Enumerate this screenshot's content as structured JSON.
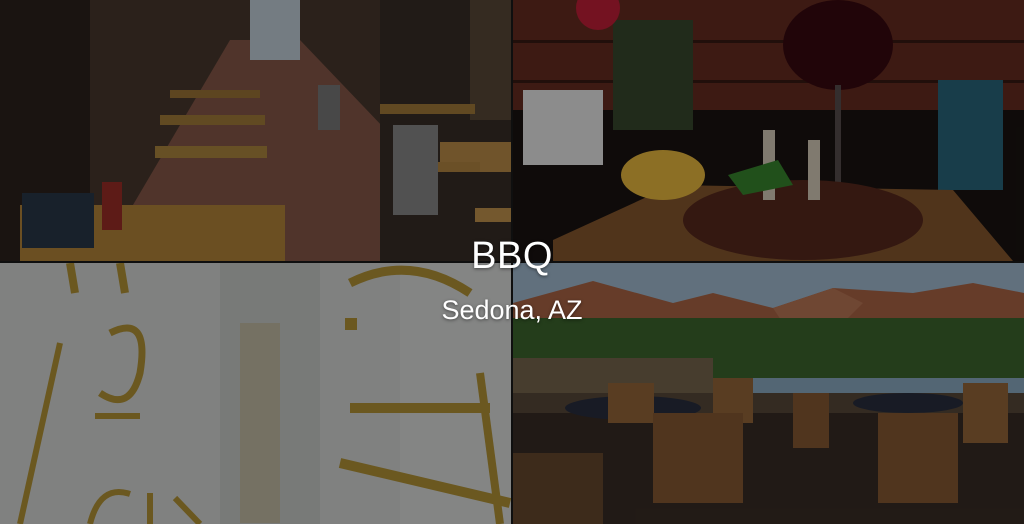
{
  "category": "BBQ",
  "location": "Sedona, AZ",
  "photos": [
    {
      "name": "indoor-dining-corridor"
    },
    {
      "name": "lamb-chops-plate"
    },
    {
      "name": "frosted-glass-door"
    },
    {
      "name": "patio-red-rock-view"
    }
  ],
  "colors": {
    "overlay": "rgba(0,0,0,0.42)",
    "caption_text": "#ffffff"
  }
}
